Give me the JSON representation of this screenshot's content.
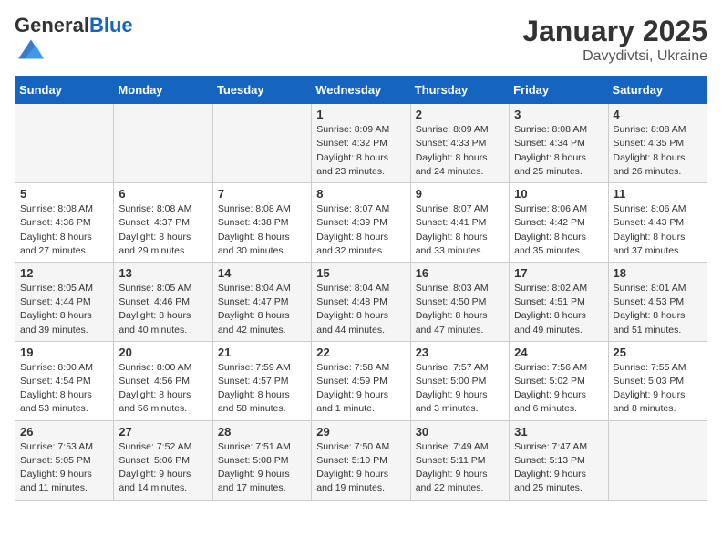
{
  "header": {
    "logo_general": "General",
    "logo_blue": "Blue",
    "month_year": "January 2025",
    "location": "Davydivtsi, Ukraine"
  },
  "weekdays": [
    "Sunday",
    "Monday",
    "Tuesday",
    "Wednesday",
    "Thursday",
    "Friday",
    "Saturday"
  ],
  "weeks": [
    [
      {
        "day": "",
        "info": ""
      },
      {
        "day": "",
        "info": ""
      },
      {
        "day": "",
        "info": ""
      },
      {
        "day": "1",
        "info": "Sunrise: 8:09 AM\nSunset: 4:32 PM\nDaylight: 8 hours\nand 23 minutes."
      },
      {
        "day": "2",
        "info": "Sunrise: 8:09 AM\nSunset: 4:33 PM\nDaylight: 8 hours\nand 24 minutes."
      },
      {
        "day": "3",
        "info": "Sunrise: 8:08 AM\nSunset: 4:34 PM\nDaylight: 8 hours\nand 25 minutes."
      },
      {
        "day": "4",
        "info": "Sunrise: 8:08 AM\nSunset: 4:35 PM\nDaylight: 8 hours\nand 26 minutes."
      }
    ],
    [
      {
        "day": "5",
        "info": "Sunrise: 8:08 AM\nSunset: 4:36 PM\nDaylight: 8 hours\nand 27 minutes."
      },
      {
        "day": "6",
        "info": "Sunrise: 8:08 AM\nSunset: 4:37 PM\nDaylight: 8 hours\nand 29 minutes."
      },
      {
        "day": "7",
        "info": "Sunrise: 8:08 AM\nSunset: 4:38 PM\nDaylight: 8 hours\nand 30 minutes."
      },
      {
        "day": "8",
        "info": "Sunrise: 8:07 AM\nSunset: 4:39 PM\nDaylight: 8 hours\nand 32 minutes."
      },
      {
        "day": "9",
        "info": "Sunrise: 8:07 AM\nSunset: 4:41 PM\nDaylight: 8 hours\nand 33 minutes."
      },
      {
        "day": "10",
        "info": "Sunrise: 8:06 AM\nSunset: 4:42 PM\nDaylight: 8 hours\nand 35 minutes."
      },
      {
        "day": "11",
        "info": "Sunrise: 8:06 AM\nSunset: 4:43 PM\nDaylight: 8 hours\nand 37 minutes."
      }
    ],
    [
      {
        "day": "12",
        "info": "Sunrise: 8:05 AM\nSunset: 4:44 PM\nDaylight: 8 hours\nand 39 minutes."
      },
      {
        "day": "13",
        "info": "Sunrise: 8:05 AM\nSunset: 4:46 PM\nDaylight: 8 hours\nand 40 minutes."
      },
      {
        "day": "14",
        "info": "Sunrise: 8:04 AM\nSunset: 4:47 PM\nDaylight: 8 hours\nand 42 minutes."
      },
      {
        "day": "15",
        "info": "Sunrise: 8:04 AM\nSunset: 4:48 PM\nDaylight: 8 hours\nand 44 minutes."
      },
      {
        "day": "16",
        "info": "Sunrise: 8:03 AM\nSunset: 4:50 PM\nDaylight: 8 hours\nand 47 minutes."
      },
      {
        "day": "17",
        "info": "Sunrise: 8:02 AM\nSunset: 4:51 PM\nDaylight: 8 hours\nand 49 minutes."
      },
      {
        "day": "18",
        "info": "Sunrise: 8:01 AM\nSunset: 4:53 PM\nDaylight: 8 hours\nand 51 minutes."
      }
    ],
    [
      {
        "day": "19",
        "info": "Sunrise: 8:00 AM\nSunset: 4:54 PM\nDaylight: 8 hours\nand 53 minutes."
      },
      {
        "day": "20",
        "info": "Sunrise: 8:00 AM\nSunset: 4:56 PM\nDaylight: 8 hours\nand 56 minutes."
      },
      {
        "day": "21",
        "info": "Sunrise: 7:59 AM\nSunset: 4:57 PM\nDaylight: 8 hours\nand 58 minutes."
      },
      {
        "day": "22",
        "info": "Sunrise: 7:58 AM\nSunset: 4:59 PM\nDaylight: 9 hours\nand 1 minute."
      },
      {
        "day": "23",
        "info": "Sunrise: 7:57 AM\nSunset: 5:00 PM\nDaylight: 9 hours\nand 3 minutes."
      },
      {
        "day": "24",
        "info": "Sunrise: 7:56 AM\nSunset: 5:02 PM\nDaylight: 9 hours\nand 6 minutes."
      },
      {
        "day": "25",
        "info": "Sunrise: 7:55 AM\nSunset: 5:03 PM\nDaylight: 9 hours\nand 8 minutes."
      }
    ],
    [
      {
        "day": "26",
        "info": "Sunrise: 7:53 AM\nSunset: 5:05 PM\nDaylight: 9 hours\nand 11 minutes."
      },
      {
        "day": "27",
        "info": "Sunrise: 7:52 AM\nSunset: 5:06 PM\nDaylight: 9 hours\nand 14 minutes."
      },
      {
        "day": "28",
        "info": "Sunrise: 7:51 AM\nSunset: 5:08 PM\nDaylight: 9 hours\nand 17 minutes."
      },
      {
        "day": "29",
        "info": "Sunrise: 7:50 AM\nSunset: 5:10 PM\nDaylight: 9 hours\nand 19 minutes."
      },
      {
        "day": "30",
        "info": "Sunrise: 7:49 AM\nSunset: 5:11 PM\nDaylight: 9 hours\nand 22 minutes."
      },
      {
        "day": "31",
        "info": "Sunrise: 7:47 AM\nSunset: 5:13 PM\nDaylight: 9 hours\nand 25 minutes."
      },
      {
        "day": "",
        "info": ""
      }
    ]
  ]
}
